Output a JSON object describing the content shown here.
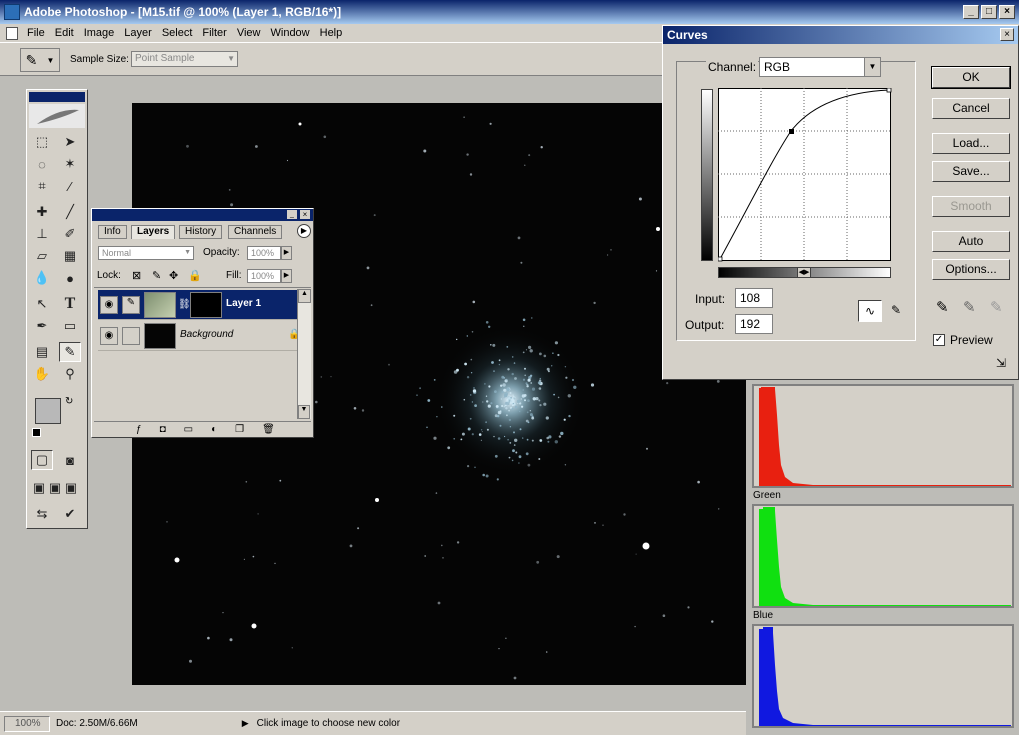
{
  "window": {
    "title": "Adobe Photoshop - [M15.tif @ 100% (Layer 1, RGB/16*)]"
  },
  "menu": {
    "items": [
      "File",
      "Edit",
      "Image",
      "Layer",
      "Select",
      "Filter",
      "View",
      "Window",
      "Help"
    ]
  },
  "options_bar": {
    "sample_size_label": "Sample Size:",
    "sample_size_value": "Point Sample"
  },
  "layers_palette": {
    "tabs": [
      "Info",
      "Layers",
      "History",
      "Channels"
    ],
    "blend_mode": "Normal",
    "opacity_label": "Opacity:",
    "opacity_value": "100%",
    "lock_label": "Lock:",
    "fill_label": "Fill:",
    "fill_value": "100%",
    "layers": [
      {
        "name": "Layer 1",
        "selected": true
      },
      {
        "name": "Background",
        "selected": false
      }
    ]
  },
  "curves": {
    "title": "Curves",
    "channel_label": "Channel:",
    "channel_value": "RGB",
    "input_label": "Input:",
    "input_value": "108",
    "output_label": "Output:",
    "output_value": "192",
    "buttons": {
      "ok": "OK",
      "cancel": "Cancel",
      "load": "Load...",
      "save": "Save...",
      "smooth": "Smooth",
      "auto": "Auto",
      "options": "Options..."
    },
    "preview_label": "Preview",
    "preview_checked": true
  },
  "histograms": {
    "green_label": "Green",
    "blue_label": "Blue"
  },
  "status_bar": {
    "zoom": "100%",
    "doc_size": "Doc: 2.50M/6.66M",
    "hint": "Click image to choose new color"
  },
  "colors": {
    "accent": "#0a246a",
    "red": "#e82010",
    "green": "#10e010",
    "blue": "#1018e0"
  }
}
